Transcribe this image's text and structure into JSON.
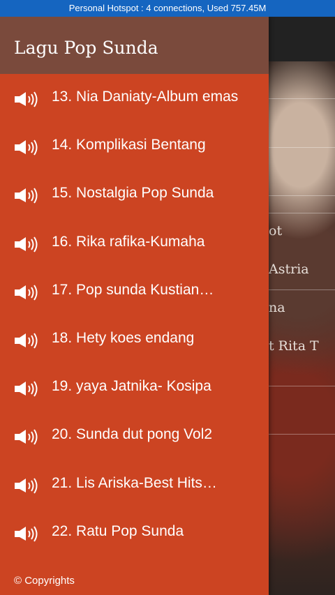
{
  "status_bar": {
    "text": "Personal Hotspot : 4 connections, Used 757.45M"
  },
  "drawer": {
    "title": "Lagu Pop Sunda",
    "items": [
      {
        "label": "13. Nia Daniaty-Album emas",
        "icon": "speaker-icon"
      },
      {
        "label": "14. Komplikasi Bentang",
        "icon": "speaker-icon"
      },
      {
        "label": "15. Nostalgia Pop Sunda",
        "icon": "speaker-icon"
      },
      {
        "label": "16. Rika rafika-Kumaha",
        "icon": "speaker-icon"
      },
      {
        "label": "17. Pop sunda Kustian…",
        "icon": "speaker-icon"
      },
      {
        "label": "18. Hety koes endang",
        "icon": "speaker-icon"
      },
      {
        "label": "19. yaya Jatnika- Kosipa",
        "icon": "speaker-icon"
      },
      {
        "label": "20. Sunda dut pong Vol2",
        "icon": "speaker-icon"
      },
      {
        "label": "21. Lis Ariska-Best Hits…",
        "icon": "speaker-icon"
      },
      {
        "label": "22. Ratu Pop Sunda",
        "icon": "speaker-icon"
      }
    ],
    "footer": "© Copyrights"
  },
  "background_list": {
    "visible_fragments": [
      "ot",
      "Astria",
      "na",
      "t Rita T"
    ]
  },
  "colors": {
    "status_bar": "#1565c0",
    "drawer": "#cc4422",
    "drawer_header": "#7a4a3c"
  }
}
